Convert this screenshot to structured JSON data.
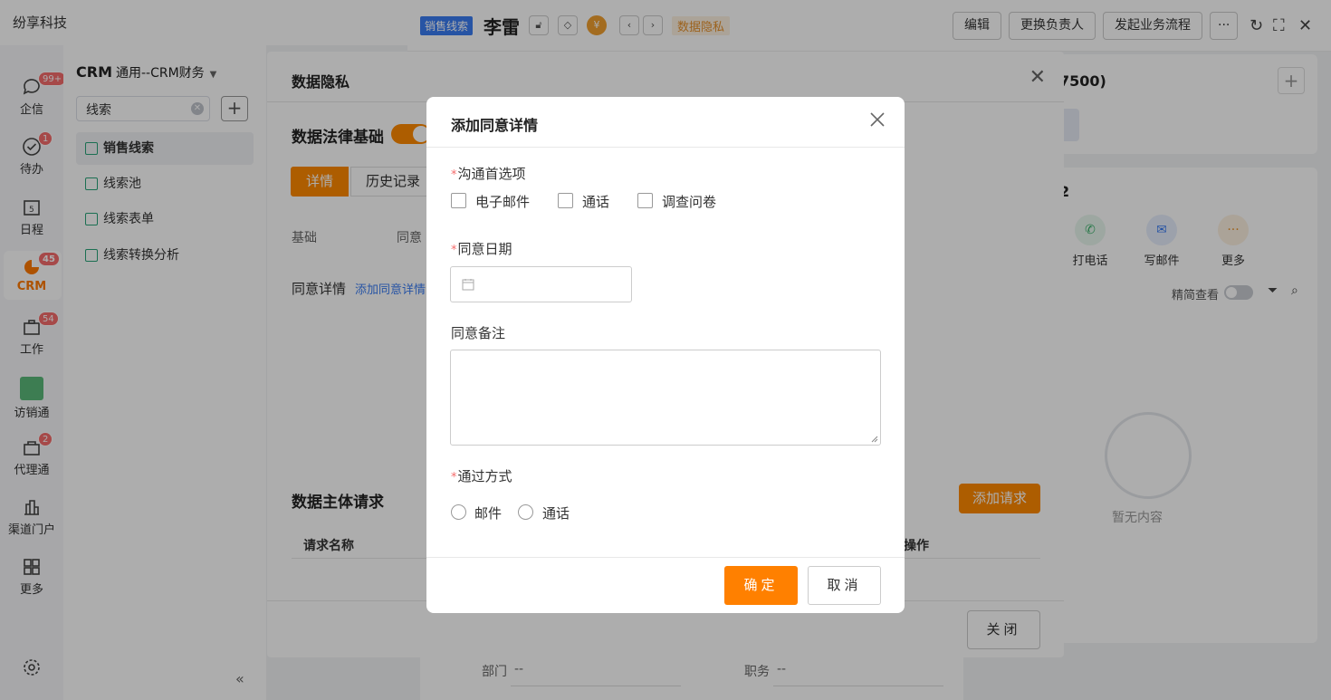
{
  "app": {
    "title": "纷享科技"
  },
  "rail": {
    "items": [
      {
        "label": "企信",
        "badge": "99+"
      },
      {
        "label": "待办",
        "badge": "1"
      },
      {
        "label": "日程",
        "badge": ""
      },
      {
        "label": "CRM",
        "badge": "45"
      },
      {
        "label": "工作",
        "badge": "54"
      },
      {
        "label": "访销通",
        "badge": ""
      },
      {
        "label": "代理通",
        "badge": "2"
      },
      {
        "label": "渠道门户",
        "badge": ""
      },
      {
        "label": "更多",
        "badge": ""
      }
    ],
    "active": "CRM"
  },
  "subnav": {
    "crm": "CRM",
    "workspace": "通用--CRM财务",
    "search_value": "线索",
    "items": [
      {
        "label": "销售线索"
      },
      {
        "label": "线索池"
      },
      {
        "label": "线索表单"
      },
      {
        "label": "线索转换分析"
      }
    ]
  },
  "record": {
    "tag": "销售线索",
    "name": "李雷",
    "privacy_tag": "数据隐私",
    "buttons": [
      "编辑",
      "更换负责人",
      "发起业务流程",
      "···"
    ]
  },
  "right_panel": {
    "count_text": "7500)",
    "num": "2",
    "actions": [
      "打电话",
      "写邮件",
      "更多"
    ],
    "toggle_label": "精简查看",
    "empty_text": "暂无内容"
  },
  "bottom_card": {
    "dept_label": "部门",
    "dept_value": "--",
    "title_label": "职务",
    "title_value": "--"
  },
  "privacy_dialog": {
    "title": "数据隐私",
    "legal_basis": "数据法律基础",
    "tabs": [
      "详情",
      "历史记录"
    ],
    "basis_label": "基础",
    "consent_label": "同意",
    "consent_detail_label": "同意详情",
    "add_consent_link": "添加同意详情",
    "subject_request": "数据主体请求",
    "add_request": "添加请求",
    "col_request_name": "请求名称",
    "col_actions": "操作",
    "close": "关闭"
  },
  "modal": {
    "title": "添加同意详情",
    "comm_pref_label": "沟通首选项",
    "comm_options": [
      "电子邮件",
      "通话",
      "调查问卷"
    ],
    "date_label": "同意日期",
    "note_label": "同意备注",
    "method_label": "通过方式",
    "method_options": [
      "邮件",
      "通话"
    ],
    "ok": "确定",
    "cancel": "取消"
  },
  "colors": {
    "accent": "#ff8000",
    "link": "#3a7cf2",
    "required": "#f56c6c"
  }
}
